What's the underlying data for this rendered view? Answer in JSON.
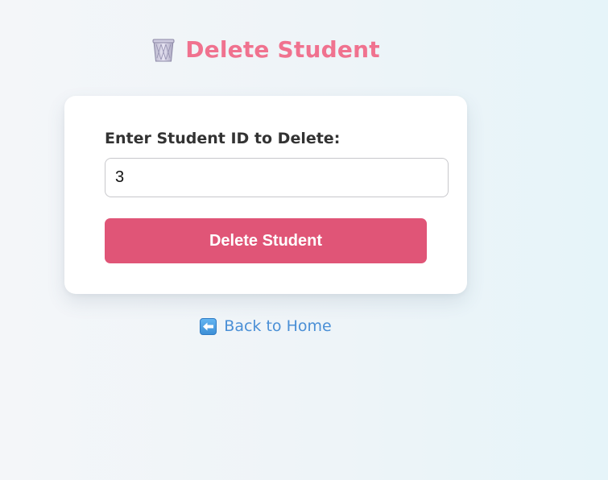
{
  "header": {
    "icon": "wastebasket-icon",
    "title": "Delete Student"
  },
  "form": {
    "label": "Enter Student ID to Delete:",
    "student_id_value": "3",
    "submit_label": "Delete Student"
  },
  "back_link": {
    "icon": "left-arrow-icon",
    "label": "Back to Home"
  },
  "colors": {
    "title": "#f0728f",
    "button": "#e05577",
    "link": "#4a8fd6"
  }
}
